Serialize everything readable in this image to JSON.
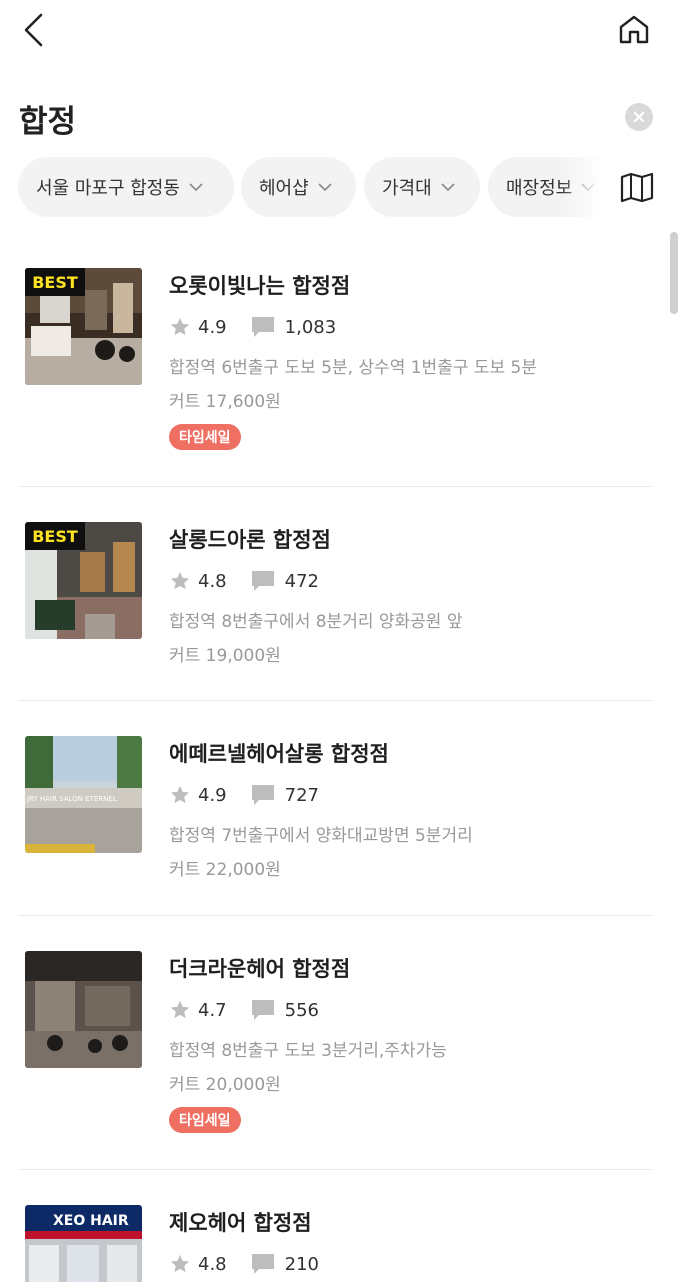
{
  "search": {
    "value": "합정",
    "placeholder": ""
  },
  "filters": [
    {
      "label": "서울 마포구 합정동"
    },
    {
      "label": "헤어샵"
    },
    {
      "label": "가격대"
    },
    {
      "label": "매장정보"
    }
  ],
  "best_label": "BEST",
  "salons": [
    {
      "name": "오롯이빛나는 합정점",
      "rating": "4.9",
      "reviews": "1,083",
      "address": "합정역 6번출구 도보 5분, 상수역 1번출구 도보 5분",
      "price": "커트 17,600원",
      "badge": "타임세일",
      "best": true
    },
    {
      "name": "살롱드아론 합정점",
      "rating": "4.8",
      "reviews": "472",
      "address": "합정역 8번출구에서 8분거리 양화공원 앞",
      "price": "커트 19,000원",
      "badge": "",
      "best": true
    },
    {
      "name": "에떼르넬헤어살롱 합정점",
      "rating": "4.9",
      "reviews": "727",
      "address": "합정역 7번출구에서 양화대교방면 5분거리",
      "price": "커트 22,000원",
      "badge": "",
      "best": false,
      "thumb_text": "JRY HAIR SALON  ETERNEL"
    },
    {
      "name": "더크라운헤어 합정점",
      "rating": "4.7",
      "reviews": "556",
      "address": "합정역 8번출구 도보 3분거리,주차가능",
      "price": "커트 20,000원",
      "badge": "타임세일",
      "best": false
    },
    {
      "name": "제오헤어 합정점",
      "rating": "4.8",
      "reviews": "210",
      "address": "",
      "price": "",
      "badge": "",
      "best": false,
      "thumb_text": "XEO HAIR"
    }
  ],
  "icons": {
    "back": "chevron-left-icon",
    "home": "home-icon",
    "clear": "clear-icon",
    "map": "map-icon",
    "star": "star-icon",
    "comment": "comment-icon",
    "chevron": "chevron-down-icon"
  },
  "colors": {
    "best_bg": "#0f0f0f",
    "best_text": "#ffe321",
    "sale_badge": "#ef6f63",
    "meta_icon": "#bdbdbd",
    "secondary_text": "#999999"
  }
}
